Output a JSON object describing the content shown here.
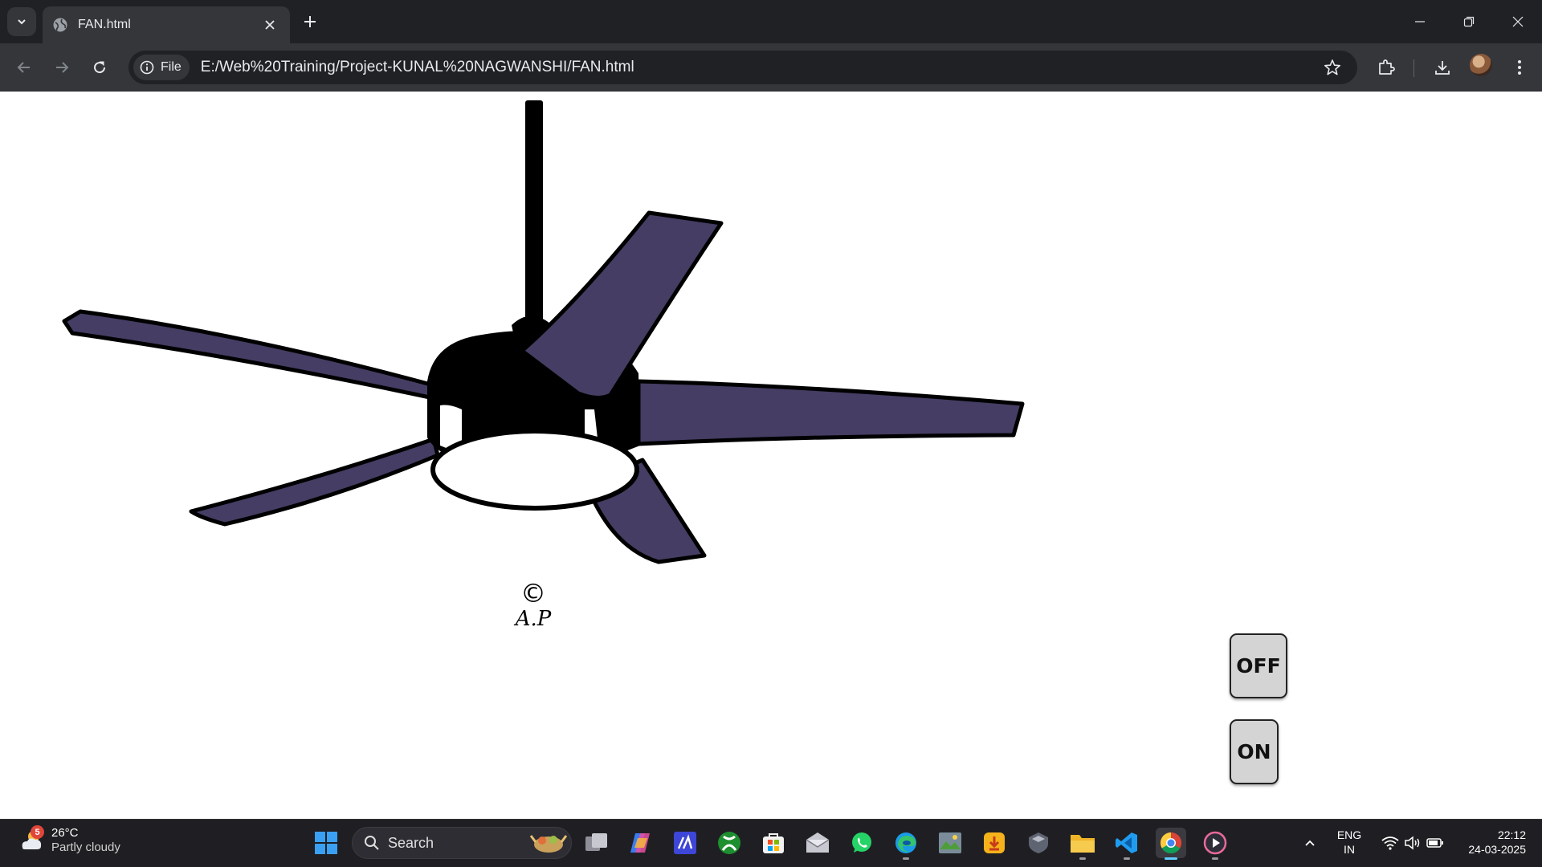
{
  "browser": {
    "tab_title": "FAN.html",
    "site_chip": "File",
    "url": "E:/Web%20Training/Project-KUNAL%20NAGWANSHI/FAN.html"
  },
  "page": {
    "copyright_symbol": "©",
    "signature": "A.P",
    "off_button": "OFF",
    "on_button": "ON",
    "blade_color": "#453d63",
    "motor_color": "#000000"
  },
  "taskbar": {
    "weather_badge": "5",
    "weather_temp": "26°C",
    "weather_desc": "Partly cloudy",
    "search_label": "Search",
    "lang_top": "ENG",
    "lang_bottom": "IN",
    "time": "22:12",
    "date": "24-03-2025",
    "pinned_apps": [
      "task-view",
      "copilot",
      "code-editor",
      "xbox",
      "microsoft-store",
      "mail",
      "whatsapp",
      "edge",
      "photos",
      "downloader",
      "shield",
      "file-explorer",
      "vscode",
      "chrome",
      "media-player"
    ]
  }
}
